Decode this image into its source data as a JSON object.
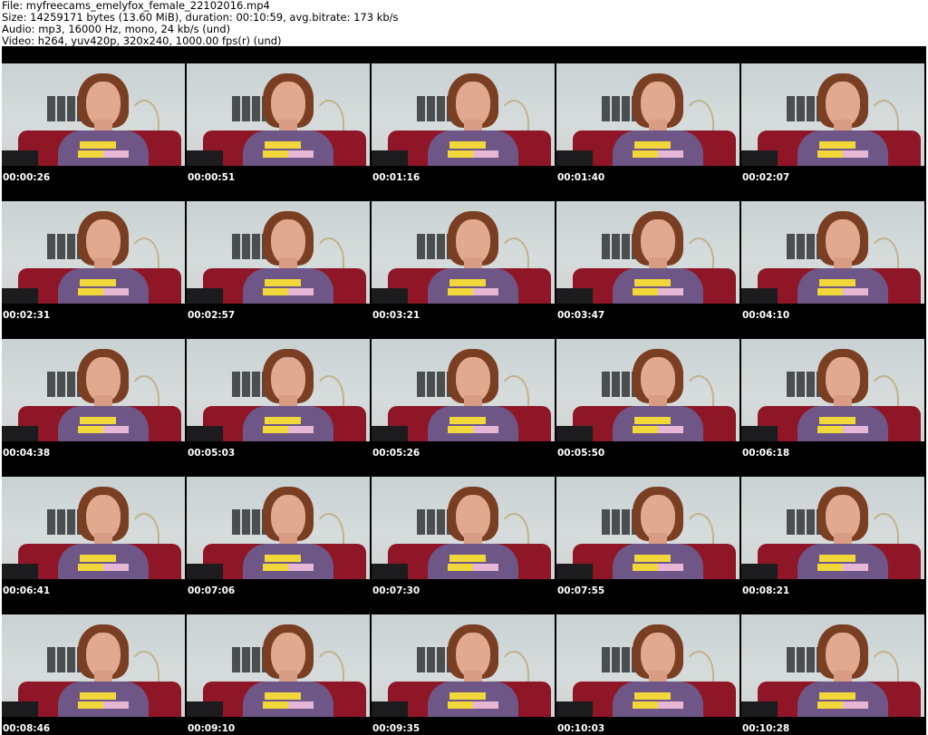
{
  "header": {
    "file_line": "File: myfreecams_emelyfox_female_22102016.mp4",
    "size_line": "Size: 14259171 bytes (13.60 MiB), duration: 00:10:59, avg.bitrate: 173 kb/s",
    "audio_line": "Audio: mp3, 16000 Hz, mono, 24 kb/s (und)",
    "video_line": "Video: h264, yuv420p, 320x240, 1000.00 fps(r) (und)"
  },
  "thumbnails": [
    {
      "timestamp": "00:00:26"
    },
    {
      "timestamp": "00:00:51"
    },
    {
      "timestamp": "00:01:16"
    },
    {
      "timestamp": "00:01:40"
    },
    {
      "timestamp": "00:02:07"
    },
    {
      "timestamp": "00:02:31"
    },
    {
      "timestamp": "00:02:57"
    },
    {
      "timestamp": "00:03:21"
    },
    {
      "timestamp": "00:03:47"
    },
    {
      "timestamp": "00:04:10"
    },
    {
      "timestamp": "00:04:38"
    },
    {
      "timestamp": "00:05:03"
    },
    {
      "timestamp": "00:05:26"
    },
    {
      "timestamp": "00:05:50"
    },
    {
      "timestamp": "00:06:18"
    },
    {
      "timestamp": "00:06:41"
    },
    {
      "timestamp": "00:07:06"
    },
    {
      "timestamp": "00:07:30"
    },
    {
      "timestamp": "00:07:55"
    },
    {
      "timestamp": "00:08:21"
    },
    {
      "timestamp": "00:08:46"
    },
    {
      "timestamp": "00:09:10"
    },
    {
      "timestamp": "00:09:35"
    },
    {
      "timestamp": "00:10:03"
    },
    {
      "timestamp": "00:10:28"
    }
  ]
}
